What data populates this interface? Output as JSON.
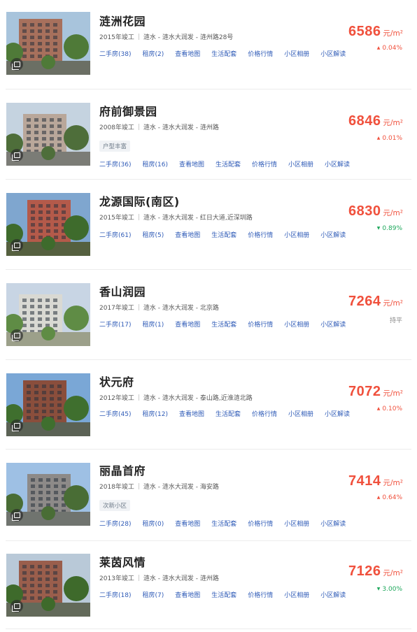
{
  "listings": [
    {
      "name": "涟洲花园",
      "year": "2015年竣工",
      "location": "涟水 - 涟水大润发 - 涟州路28号",
      "tag": "",
      "price": "6586",
      "unit": "元/m²",
      "change": "0.04%",
      "trend": "up",
      "links": [
        "二手房(38)",
        "租房(2)",
        "查看地图",
        "生活配套",
        "价格行情",
        "小区相册",
        "小区解读"
      ]
    },
    {
      "name": "府前御景园",
      "year": "2008年竣工",
      "location": "涟水 - 涟水大润发 - 涟州路",
      "tag": "户型丰富",
      "price": "6846",
      "unit": "元/m²",
      "change": "0.01%",
      "trend": "up",
      "links": [
        "二手房(36)",
        "租房(16)",
        "查看地图",
        "生活配套",
        "价格行情",
        "小区相册",
        "小区解读"
      ]
    },
    {
      "name": "龙源国际(南区)",
      "year": "2015年竣工",
      "location": "涟水 - 涟水大润发 - 红日大道,近深圳路",
      "tag": "",
      "price": "6830",
      "unit": "元/m²",
      "change": "0.89%",
      "trend": "down",
      "links": [
        "二手房(61)",
        "租房(5)",
        "查看地图",
        "生活配套",
        "价格行情",
        "小区相册",
        "小区解读"
      ]
    },
    {
      "name": "香山润园",
      "year": "2017年竣工",
      "location": "涟水 - 涟水大润发 - 北京路",
      "tag": "",
      "price": "7264",
      "unit": "元/m²",
      "change": "持平",
      "trend": "flat",
      "links": [
        "二手房(17)",
        "租房(1)",
        "查看地图",
        "生活配套",
        "价格行情",
        "小区相册",
        "小区解读"
      ]
    },
    {
      "name": "状元府",
      "year": "2012年竣工",
      "location": "涟水 - 涟水大润发 - 泰山路,近淮涟北路",
      "tag": "",
      "price": "7072",
      "unit": "元/m²",
      "change": "0.10%",
      "trend": "up",
      "links": [
        "二手房(45)",
        "租房(12)",
        "查看地图",
        "生活配套",
        "价格行情",
        "小区相册",
        "小区解读"
      ]
    },
    {
      "name": "丽晶首府",
      "year": "2018年竣工",
      "location": "涟水 - 涟水大润发 - 海安路",
      "tag": "次新小区",
      "price": "7414",
      "unit": "元/m²",
      "change": "0.64%",
      "trend": "up",
      "links": [
        "二手房(28)",
        "租房(0)",
        "查看地图",
        "生活配套",
        "价格行情",
        "小区相册",
        "小区解读"
      ]
    },
    {
      "name": "莱茵风情",
      "year": "2013年竣工",
      "location": "涟水 - 涟水大润发 - 涟州路",
      "tag": "",
      "price": "7126",
      "unit": "元/m²",
      "change": "3.00%",
      "trend": "down",
      "links": [
        "二手房(18)",
        "租房(7)",
        "查看地图",
        "生活配套",
        "价格行情",
        "小区相册",
        "小区解读"
      ]
    }
  ],
  "colors": {
    "price": "#f0503c",
    "rise": "#f0503c",
    "fall": "#1ea85c",
    "flat": "#888888",
    "link": "#2f5bb7"
  },
  "icons": {
    "photo_badge": "album-icon",
    "rise": "triangle-up-icon",
    "fall": "triangle-down-icon"
  }
}
